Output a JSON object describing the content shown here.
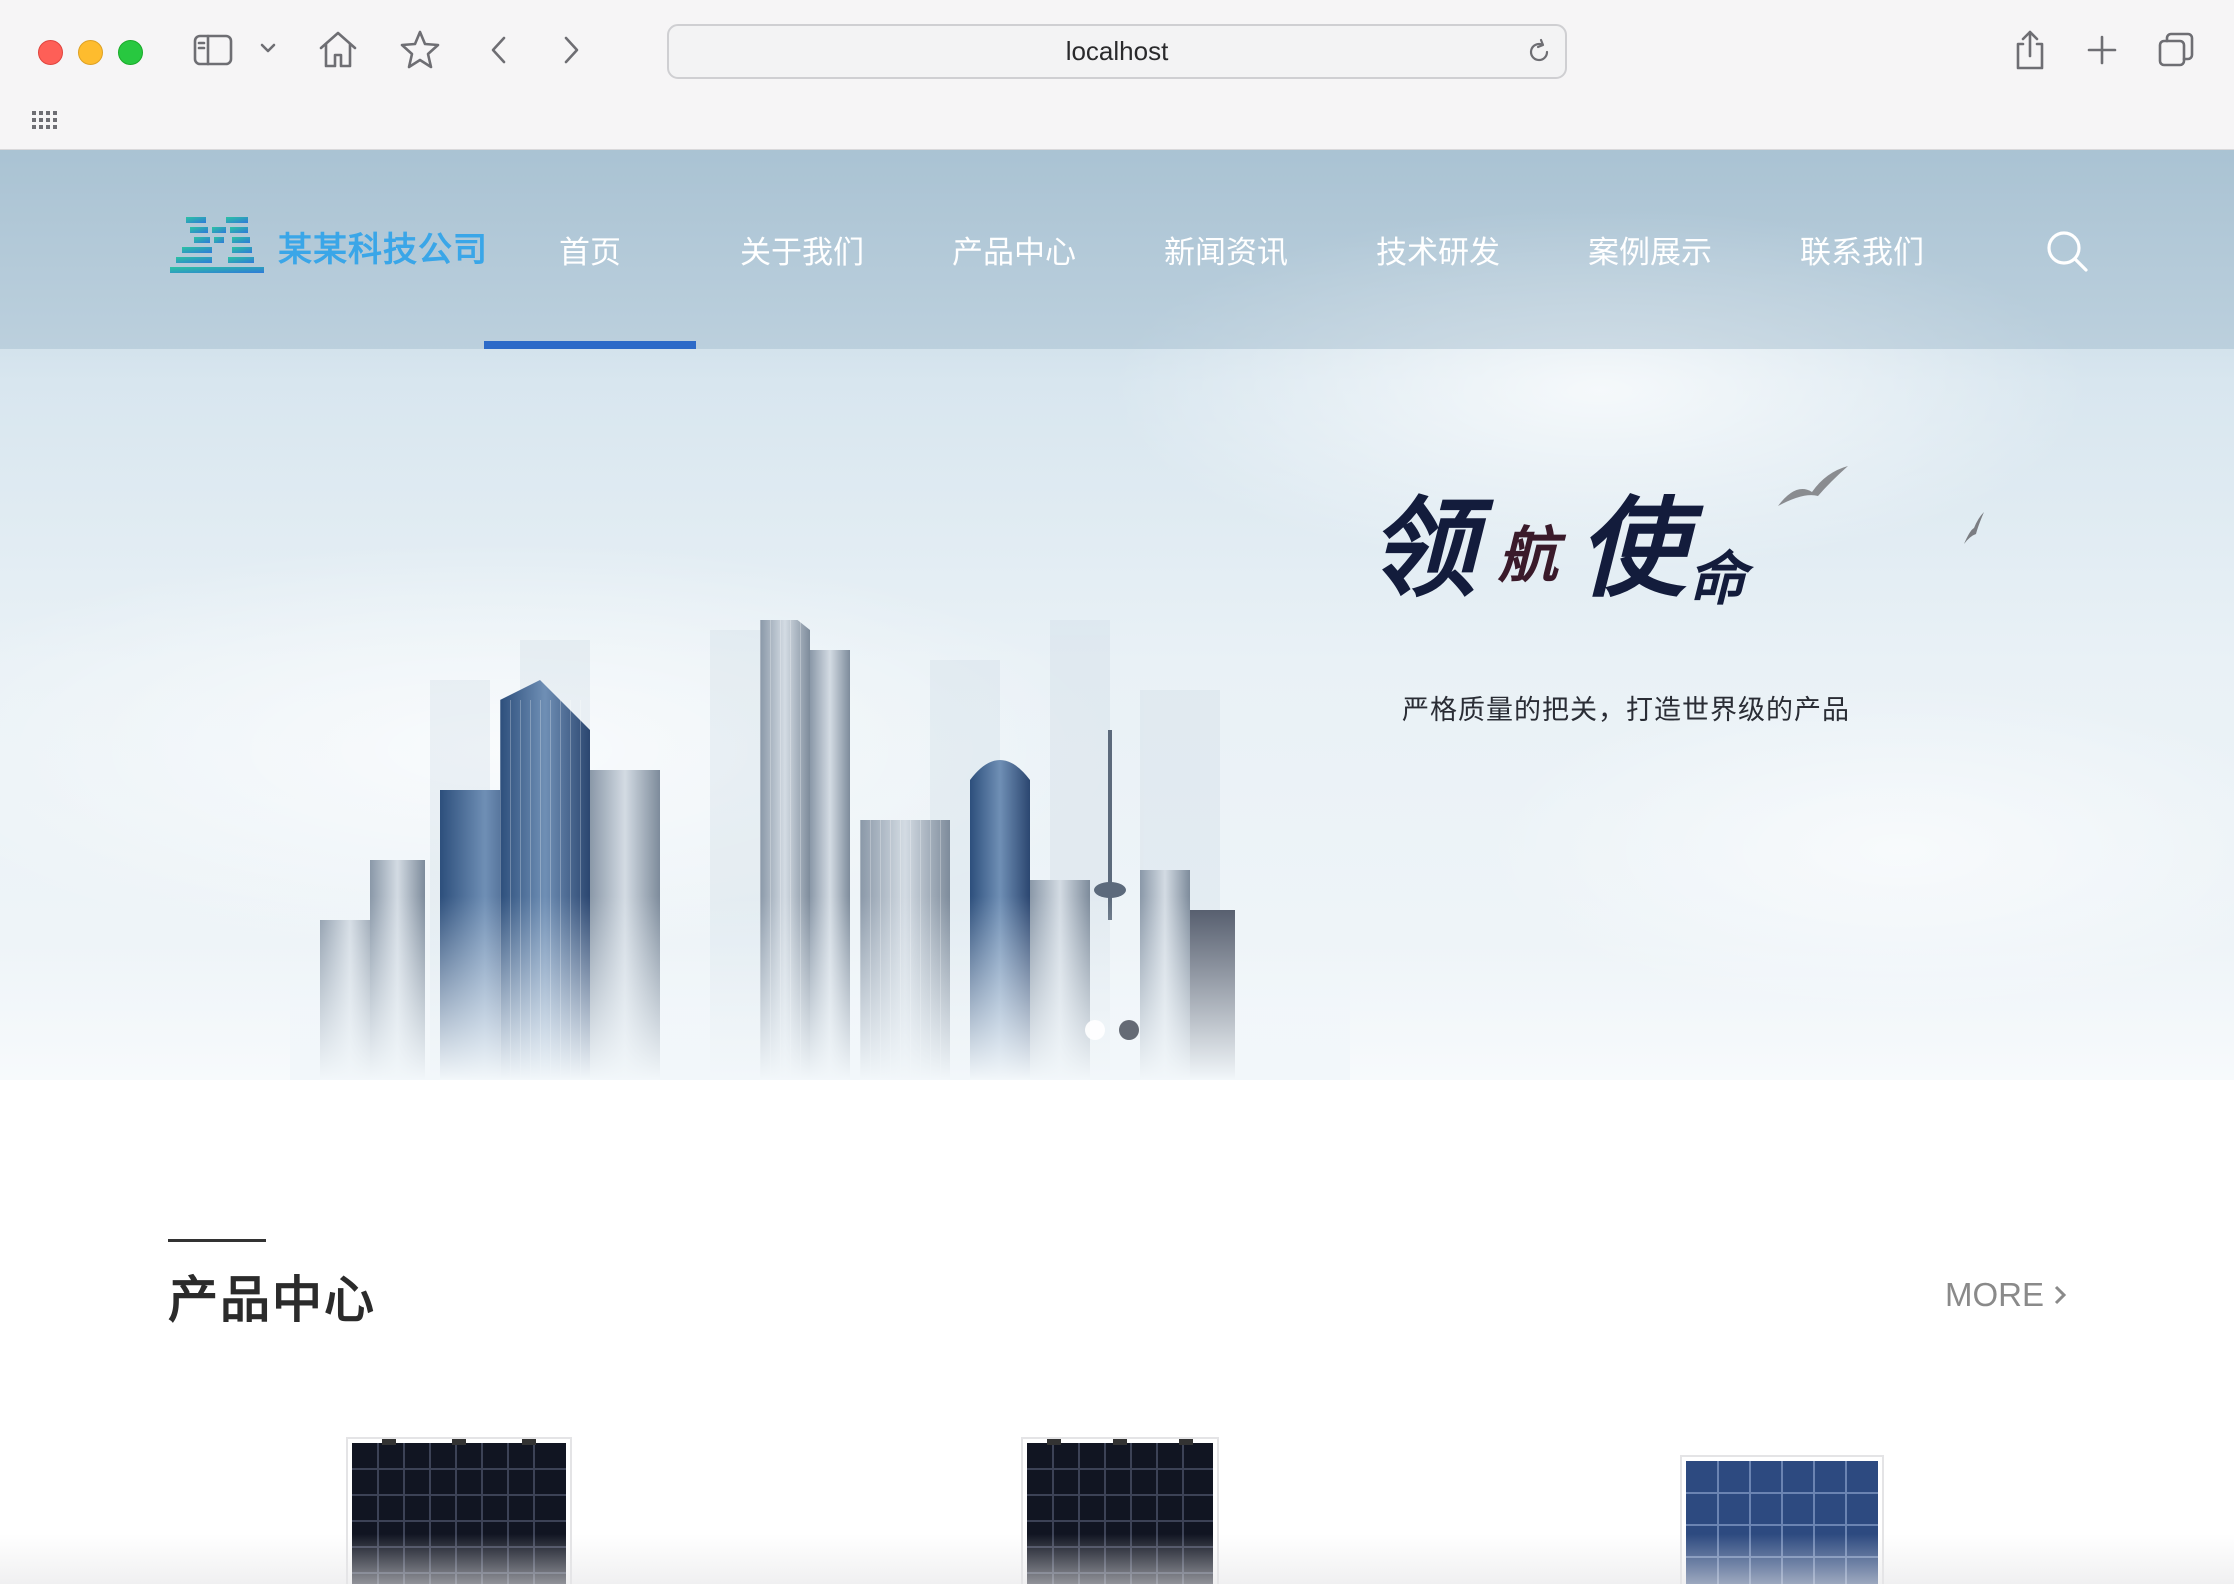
{
  "browser": {
    "address": "localhost"
  },
  "site": {
    "logo_text": "某某科技公司",
    "nav": [
      {
        "label": "首页",
        "active": true
      },
      {
        "label": "关于我们",
        "active": false
      },
      {
        "label": "产品中心",
        "active": false
      },
      {
        "label": "新闻资讯",
        "active": false
      },
      {
        "label": "技术研发",
        "active": false
      },
      {
        "label": "案例展示",
        "active": false
      },
      {
        "label": "联系我们",
        "active": false
      }
    ],
    "accent_color": "#2c6ac8"
  },
  "hero": {
    "slogan_chars": [
      "领",
      "航",
      "使",
      "命"
    ],
    "tagline": "严格质量的把关，打造世界级的产品",
    "carousel_total": 2,
    "carousel_active": 2
  },
  "products_section": {
    "title": "产品中心",
    "more_label": "MORE",
    "items": [
      "solar-panel-mono",
      "solar-panel-mono",
      "solar-panel-poly"
    ]
  }
}
